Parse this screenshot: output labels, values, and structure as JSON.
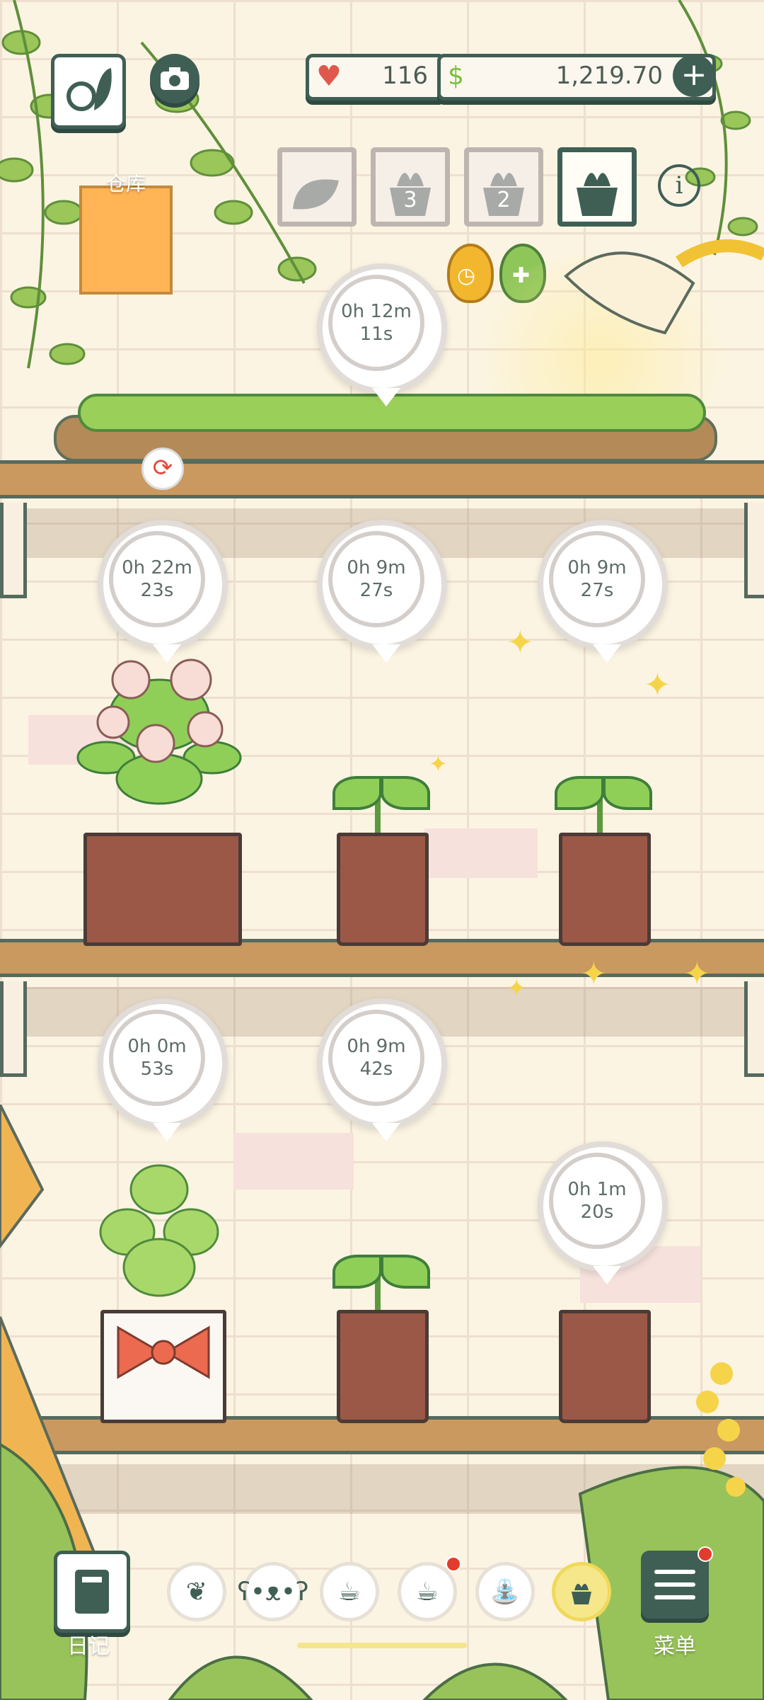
{
  "currency": {
    "hearts": "116",
    "money": "1,219.70"
  },
  "storage_label": "仓库",
  "slots": [
    {
      "name": "seed",
      "count": ""
    },
    {
      "name": "pot-3",
      "count": "3"
    },
    {
      "name": "pot-2",
      "count": "2"
    },
    {
      "name": "pot-selected",
      "count": ""
    }
  ],
  "timers": {
    "tray": "0h 12m\n11s",
    "shelf1_a": "0h 22m\n23s",
    "shelf1_b": "0h 9m 27s",
    "shelf1_c": "0h 9m 27s",
    "shelf2_a": "0h 0m 53s",
    "shelf2_b": "0h 9m 42s",
    "shelf2_c": "0h 1m 20s"
  },
  "bottom_bar": {
    "diary_label": "日记",
    "menu_label": "菜单",
    "icons": [
      "leaf-basket-icon",
      "bear-icon",
      "cup-icon",
      "cup-icon",
      "watering-can-icon",
      "plant-icon"
    ]
  },
  "colors": {
    "accent": "#3f5f55",
    "shelf": "#c9995f",
    "pot": "#9b5847",
    "notify": "#e23c2c"
  }
}
